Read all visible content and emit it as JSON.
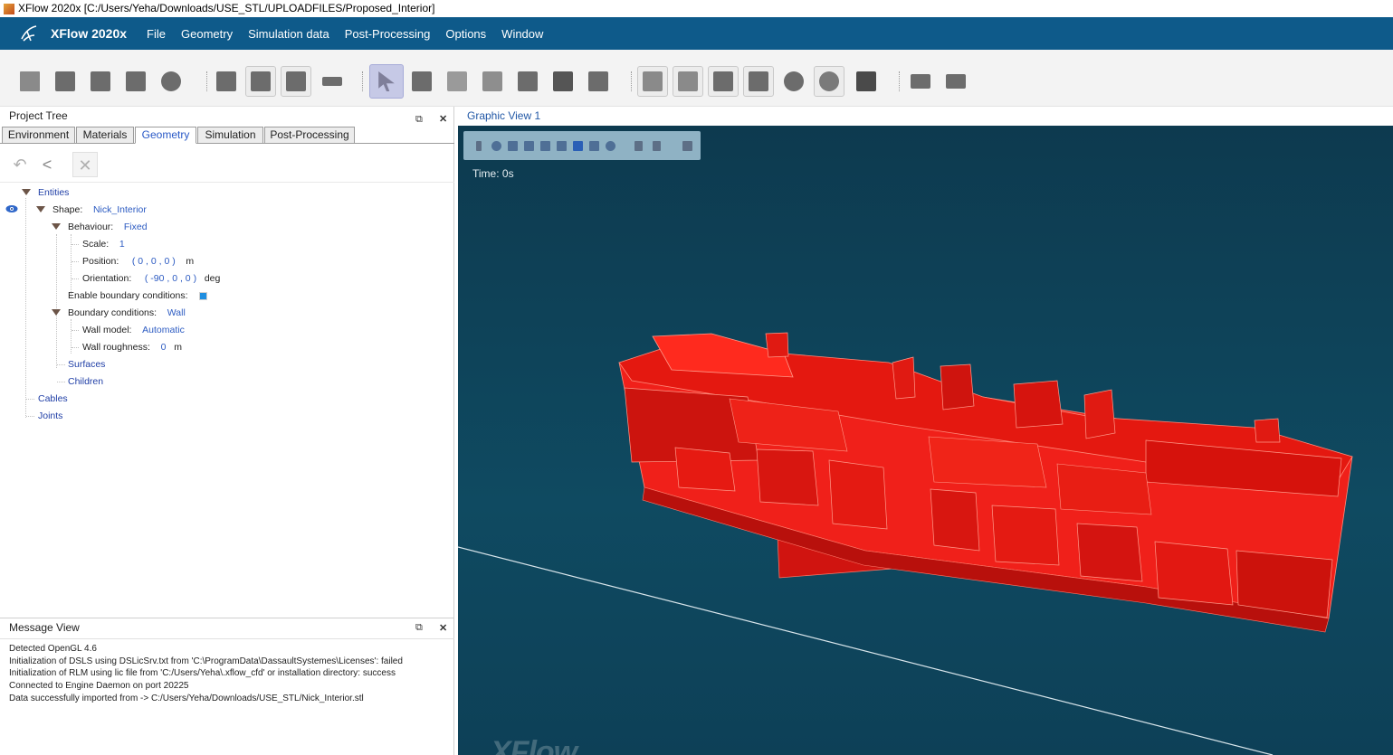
{
  "window": {
    "title": "XFlow 2020x [C:/Users/Yeha/Downloads/USE_STL/UPLOADFILES/Proposed_Interior]"
  },
  "menubar": {
    "brand": "XFlow 2020x",
    "items": [
      "File",
      "Geometry",
      "Simulation data",
      "Post-Processing",
      "Options",
      "Window"
    ]
  },
  "toolbar": {
    "icons": [
      "new-xfp-icon",
      "open-folder-icon",
      "save-icon",
      "save-as-icon",
      "settings-icon",
      "import-geometry-icon",
      "export-geometry-icon",
      "box-shape-icon",
      "ruler-icon",
      "select-arrow-icon",
      "select-entity-icon",
      "select-face-icon",
      "select-edge-icon",
      "select-vertex-icon",
      "select-solid-icon",
      "select-wire-icon",
      "boolean-union-icon",
      "boolean-subtract-icon",
      "measure-icon",
      "zoom-box-icon",
      "probe-icon",
      "probe-active-icon",
      "clapperboard-icon",
      "snapshot-icon",
      "plot-icon"
    ],
    "selected": "select-arrow-icon"
  },
  "project_tree": {
    "title": "Project Tree",
    "tabs": [
      "Environment",
      "Materials",
      "Geometry",
      "Simulation",
      "Post-Processing"
    ],
    "active_tab": "Geometry",
    "entities_label": "Entities",
    "shape_key": "Shape:",
    "shape_val": "Nick_Interior",
    "behaviour_key": "Behaviour:",
    "behaviour_val": "Fixed",
    "scale_key": "Scale:",
    "scale_val": "1",
    "position_key": "Position:",
    "position_val": "( 0 , 0 , 0 )",
    "position_unit": "m",
    "orientation_key": "Orientation:",
    "orientation_val": "( -90 , 0 , 0 )",
    "orientation_unit": "deg",
    "enable_bc_key": "Enable boundary conditions:",
    "bc_key": "Boundary conditions:",
    "bc_val": "Wall",
    "wall_model_key": "Wall model:",
    "wall_model_val": "Automatic",
    "roughness_key": "Wall roughness:",
    "roughness_val": "0",
    "roughness_unit": "m",
    "surfaces": "Surfaces",
    "children": "Children",
    "cables": "Cables",
    "joints": "Joints"
  },
  "message_view": {
    "title": "Message View",
    "lines": [
      "Detected OpenGL 4.6",
      "Initialization of DSLS using DSLicSrv.txt from 'C:\\ProgramData\\DassaultSystemes\\Licenses': failed",
      "Initialization of RLM using lic file from 'C:/Users/Yeha\\.xflow_cfd' or installation directory: success",
      "Connected to Engine Daemon on port 20225",
      "Data successfully imported from -> C:/Users/Yeha/Downloads/USE_STL/Nick_Interior.stl"
    ]
  },
  "graphic_view": {
    "title": "Graphic View 1",
    "time_label": "Time: 0s",
    "watermark": "XFlow",
    "model_color": "#e8140f",
    "background": "#0e4257"
  },
  "pane_controls": {
    "float": "⧉",
    "close": "✕"
  }
}
